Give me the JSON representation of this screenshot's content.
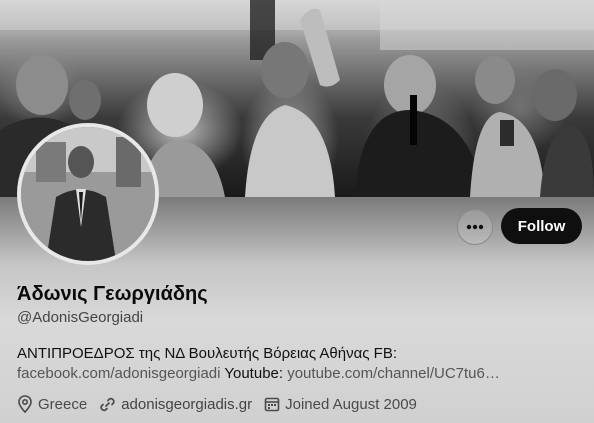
{
  "profile": {
    "display_name": "Άδωνις Γεωργιάδης",
    "handle": "@AdonisGeorgiadi",
    "bio_line1": "ΑΝΤΙΠΡΟΕΔΡΟΣ της ΝΔ Βουλευτής Βόρειας Αθήνας FB:",
    "bio_link1": "facebook.com/adonisgeorgiadi",
    "bio_mid": " Youtube: ",
    "bio_link2": "youtube.com/channel/UC7tu6…"
  },
  "actions": {
    "follow_label": "Follow",
    "more_icon": "more-dots-icon"
  },
  "meta": {
    "location": "Greece",
    "website": "adonisgeorgiadis.gr",
    "joined": "Joined August 2009",
    "icons": [
      "location-pin-icon",
      "link-icon",
      "calendar-icon"
    ]
  }
}
